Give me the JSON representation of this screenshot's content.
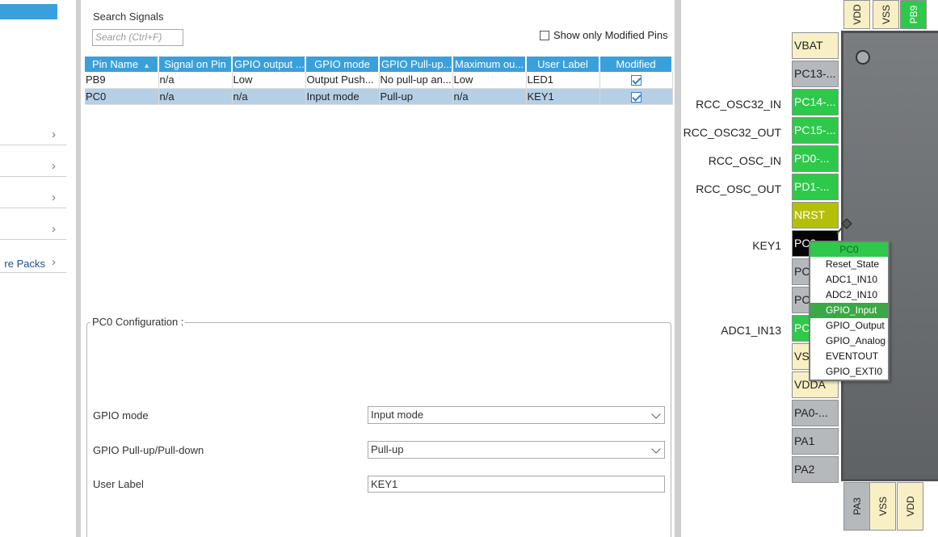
{
  "sidebar": {
    "items": [
      {
        "label": ""
      },
      {
        "label": ""
      },
      {
        "label": ""
      },
      {
        "label": ""
      },
      {
        "label": "re Packs"
      }
    ]
  },
  "signals": {
    "title": "Search Signals",
    "search_placeholder": "Search (Ctrl+F)",
    "show_modified_label": "Show only Modified Pins"
  },
  "table": {
    "headers": [
      "Pin Name",
      "Signal on Pin",
      "GPIO output ...",
      "GPIO mode",
      "GPIO Pull-up...",
      "Maximum ou...",
      "User Label",
      "Modified"
    ],
    "rows": [
      {
        "pin": "PB9",
        "signal": "n/a",
        "output": "Low",
        "mode": "Output Push...",
        "pull": "No pull-up an...",
        "max": "Low",
        "label": "LED1",
        "modified": true
      },
      {
        "pin": "PC0",
        "signal": "n/a",
        "output": "n/a",
        "mode": "Input mode",
        "pull": "Pull-up",
        "max": "n/a",
        "label": "KEY1",
        "modified": true
      }
    ]
  },
  "config": {
    "title": "PC0 Configuration :",
    "gpio_mode_label": "GPIO mode",
    "gpio_mode_value": "Input mode",
    "pull_label": "GPIO Pull-up/Pull-down",
    "pull_value": "Pull-up",
    "user_label_label": "User Label",
    "user_label_value": "KEY1"
  },
  "chip": {
    "top_pins": [
      "VDD",
      "VSS",
      "PB9"
    ],
    "bottom_pins": [
      "PA3",
      "VSS",
      "VDD"
    ],
    "left_pins": [
      "VBAT",
      "PC13-...",
      "PC14-...",
      "PC15-...",
      "PD0-...",
      "PD1-...",
      "NRST",
      "PC0",
      "PC",
      "PC",
      "PC",
      "VS",
      "VDDA",
      "PA0-...",
      "PA1",
      "PA2"
    ],
    "signals": [
      "RCC_OSC32_IN",
      "RCC_OSC32_OUT",
      "RCC_OSC_IN",
      "RCC_OSC_OUT",
      "KEY1",
      "ADC1_IN13"
    ]
  },
  "popup": {
    "header": "PC0",
    "items": [
      "Reset_State",
      "ADC1_IN10",
      "ADC2_IN10",
      "GPIO_Input",
      "GPIO_Output",
      "GPIO_Analog",
      "EVENTOUT",
      "GPIO_EXTI0"
    ],
    "selected": "GPIO_Input"
  },
  "colors": {
    "accent": "#3aa0db",
    "pin_green": "#2ec94a",
    "pin_cream": "#f8f0c4",
    "pin_olive": "#b4bf0a"
  }
}
